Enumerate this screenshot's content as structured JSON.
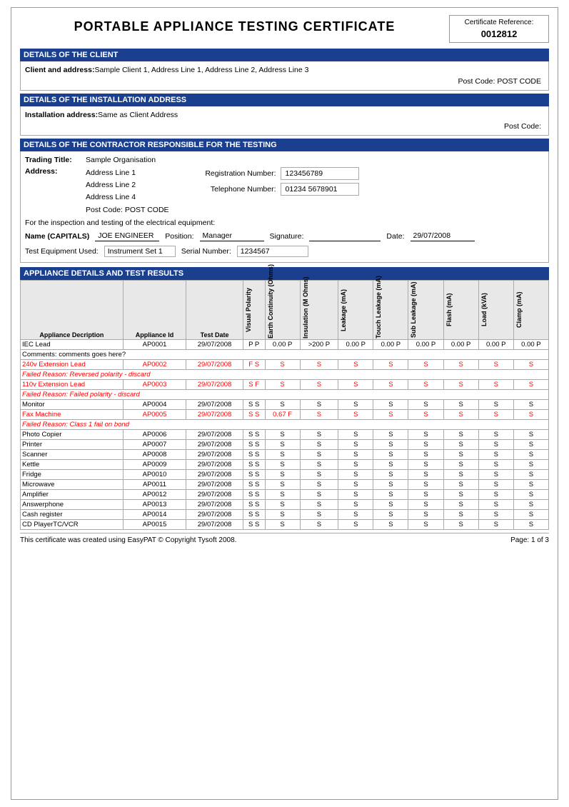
{
  "page": {
    "title": "PORTABLE APPLIANCE TESTING CERTIFICATE",
    "cert_ref_label": "Certificate Reference:",
    "cert_ref_number": "0012812"
  },
  "client_section": {
    "header": "DETAILS OF THE CLIENT",
    "client_label": "Client and address:",
    "client_value": "Sample Client 1, Address Line 1, Address Line 2, Address Line 3",
    "postcode_label": "Post Code:",
    "postcode_value": "POST CODE"
  },
  "installation_section": {
    "header": "DETAILS OF THE INSTALLATION ADDRESS",
    "address_label": "Installation address:",
    "address_value": "Same as Client Address",
    "postcode_label": "Post Code:",
    "postcode_value": ""
  },
  "contractor_section": {
    "header": "DETAILS OF THE CONTRACTOR RESPONSIBLE FOR THE TESTING",
    "trading_label": "Trading Title:",
    "trading_value": "Sample Organisation",
    "address_label": "Address:",
    "address_lines": [
      "Address Line 1",
      "Address Line 2",
      "Address Line 4"
    ],
    "postcode_label": "Post Code:",
    "postcode_value": "POST CODE",
    "reg_number_label": "Registration Number:",
    "reg_number_value": "123456789",
    "tel_label": "Telephone Number:",
    "tel_value": "01234 5678901",
    "inspection_text": "For the inspection and testing of the electrical equipment:",
    "name_label": "Name (CAPITALS)",
    "name_value": "JOE ENGINEER",
    "position_label": "Position:",
    "position_value": "Manager",
    "signature_label": "Signature:",
    "signature_value": "",
    "date_label": "Date:",
    "date_value": "29/07/2008",
    "test_eq_label": "Test Equipment Used:",
    "test_eq_value": "Instrument Set 1",
    "serial_label": "Serial Number:",
    "serial_value": "1234567"
  },
  "appliance_section": {
    "header": "APPLIANCE DETAILS AND TEST RESULTS",
    "columns": {
      "desc": "Appliance Decription",
      "id": "Appliance Id",
      "date": "Test Date",
      "visual": "Visual Polarity",
      "earth": "Earth Continuity (Ohms)",
      "insulation": "Insulation (M Ohms)",
      "leakage": "Leakage (mA)",
      "touch": "Touch Leakage (mA)",
      "sub": "Sub Leakage (mA)",
      "flash": "Flash (mA)",
      "load": "Load (kVA)",
      "clamp": "Clamp (mA)"
    },
    "rows": [
      {
        "desc": "IEC Lead",
        "id": "AP0001",
        "date": "29/07/2008",
        "visual": "P P",
        "earth": "0.00 P",
        "insulation": ">200 P",
        "leakage": "0.00 P",
        "touch": "0.00 P",
        "sub": "0.00 P",
        "flash": "0.00 P",
        "load": "0.00 P",
        "clamp": "0.00 P",
        "status": "pass",
        "comment": "Comments: comments goes here?"
      },
      {
        "desc": "240v Extension Lead",
        "id": "AP0002",
        "date": "29/07/2008",
        "visual": "F S",
        "earth": "S",
        "insulation": "S",
        "leakage": "S",
        "touch": "S",
        "sub": "S",
        "flash": "S",
        "load": "S",
        "clamp": "S",
        "status": "fail",
        "fail_reason": "Failed Reason: Reversed polarity - discard"
      },
      {
        "desc": "110v Extension Lead",
        "id": "AP0003",
        "date": "29/07/2008",
        "visual": "S F",
        "earth": "S",
        "insulation": "S",
        "leakage": "S",
        "touch": "S",
        "sub": "S",
        "flash": "S",
        "load": "S",
        "clamp": "S",
        "status": "fail",
        "fail_reason": "Failed Reason: Failed polarity - discard"
      },
      {
        "desc": "Monitor",
        "id": "AP0004",
        "date": "29/07/2008",
        "visual": "S S",
        "earth": "S",
        "insulation": "S",
        "leakage": "S",
        "touch": "S",
        "sub": "S",
        "flash": "S",
        "load": "S",
        "clamp": "S",
        "status": "pass"
      },
      {
        "desc": "Fax Machine",
        "id": "AP0005",
        "date": "29/07/2008",
        "visual": "S S",
        "earth": "0.67 F",
        "insulation": "S",
        "leakage": "S",
        "touch": "S",
        "sub": "S",
        "flash": "S",
        "load": "S",
        "clamp": "S",
        "status": "fail",
        "fail_reason": "Failed Reason: Class 1 fail on bond"
      },
      {
        "desc": "Photo Copier",
        "id": "AP0006",
        "date": "29/07/2008",
        "visual": "S S",
        "earth": "S",
        "insulation": "S",
        "leakage": "S",
        "touch": "S",
        "sub": "S",
        "flash": "S",
        "load": "S",
        "clamp": "S",
        "status": "pass"
      },
      {
        "desc": "Printer",
        "id": "AP0007",
        "date": "29/07/2008",
        "visual": "S S",
        "earth": "S",
        "insulation": "S",
        "leakage": "S",
        "touch": "S",
        "sub": "S",
        "flash": "S",
        "load": "S",
        "clamp": "S",
        "status": "pass"
      },
      {
        "desc": "Scanner",
        "id": "AP0008",
        "date": "29/07/2008",
        "visual": "S S",
        "earth": "S",
        "insulation": "S",
        "leakage": "S",
        "touch": "S",
        "sub": "S",
        "flash": "S",
        "load": "S",
        "clamp": "S",
        "status": "pass"
      },
      {
        "desc": "Kettle",
        "id": "AP0009",
        "date": "29/07/2008",
        "visual": "S S",
        "earth": "S",
        "insulation": "S",
        "leakage": "S",
        "touch": "S",
        "sub": "S",
        "flash": "S",
        "load": "S",
        "clamp": "S",
        "status": "pass"
      },
      {
        "desc": "Fridge",
        "id": "AP0010",
        "date": "29/07/2008",
        "visual": "S S",
        "earth": "S",
        "insulation": "S",
        "leakage": "S",
        "touch": "S",
        "sub": "S",
        "flash": "S",
        "load": "S",
        "clamp": "S",
        "status": "pass"
      },
      {
        "desc": "Microwave",
        "id": "AP0011",
        "date": "29/07/2008",
        "visual": "S S",
        "earth": "S",
        "insulation": "S",
        "leakage": "S",
        "touch": "S",
        "sub": "S",
        "flash": "S",
        "load": "S",
        "clamp": "S",
        "status": "pass"
      },
      {
        "desc": "Amplifier",
        "id": "AP0012",
        "date": "29/07/2008",
        "visual": "S S",
        "earth": "S",
        "insulation": "S",
        "leakage": "S",
        "touch": "S",
        "sub": "S",
        "flash": "S",
        "load": "S",
        "clamp": "S",
        "status": "pass"
      },
      {
        "desc": "Answerphone",
        "id": "AP0013",
        "date": "29/07/2008",
        "visual": "S S",
        "earth": "S",
        "insulation": "S",
        "leakage": "S",
        "touch": "S",
        "sub": "S",
        "flash": "S",
        "load": "S",
        "clamp": "S",
        "status": "pass"
      },
      {
        "desc": "Cash register",
        "id": "AP0014",
        "date": "29/07/2008",
        "visual": "S S",
        "earth": "S",
        "insulation": "S",
        "leakage": "S",
        "touch": "S",
        "sub": "S",
        "flash": "S",
        "load": "S",
        "clamp": "S",
        "status": "pass"
      },
      {
        "desc": "CD PlayerTC/VCR",
        "id": "AP0015",
        "date": "29/07/2008",
        "visual": "S S",
        "earth": "S",
        "insulation": "S",
        "leakage": "S",
        "touch": "S",
        "sub": "S",
        "flash": "S",
        "load": "S",
        "clamp": "S",
        "status": "pass"
      }
    ]
  },
  "footer": {
    "copyright": "This certificate was created using EasyPAT © Copyright Tysoft 2008.",
    "page": "Page: 1 of 3"
  }
}
